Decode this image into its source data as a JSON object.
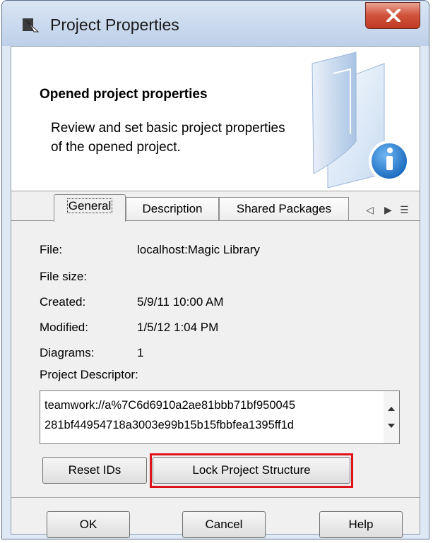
{
  "window": {
    "title": "Project Properties",
    "close_symbol": "X"
  },
  "header": {
    "title": "Opened project properties",
    "description": "Review and set basic project properties of the opened project."
  },
  "tabs": [
    {
      "label": "General",
      "active": true
    },
    {
      "label": "Description",
      "active": false
    },
    {
      "label": "Shared Packages",
      "active": false
    }
  ],
  "tab_nav": {
    "prev": "◁",
    "next": "▶",
    "menu": "☰"
  },
  "general": {
    "file_label": "File:",
    "file_value": "localhost:Magic Library",
    "file_size_label": "File size:",
    "file_size_value": "",
    "created_label": "Created:",
    "created_value": "5/9/11 10:00 AM",
    "modified_label": "Modified:",
    "modified_value": "1/5/12 1:04 PM",
    "diagrams_label": "Diagrams:",
    "diagrams_value": "1",
    "descriptor_label": "Project Descriptor:",
    "descriptor_value": "teamwork://a%7C6d6910a2ae81bbb71bf950045\n281bf44954718a3003e99b15b15fbbfea1395ff1d"
  },
  "actions": {
    "reset_ids": "Reset IDs",
    "lock_structure": "Lock Project Structure"
  },
  "footer": {
    "ok": "OK",
    "cancel": "Cancel",
    "help": "Help"
  },
  "colors": {
    "highlight": "#e0131a",
    "close_button": "#c03a22",
    "info_badge": "#1e7fd6"
  }
}
